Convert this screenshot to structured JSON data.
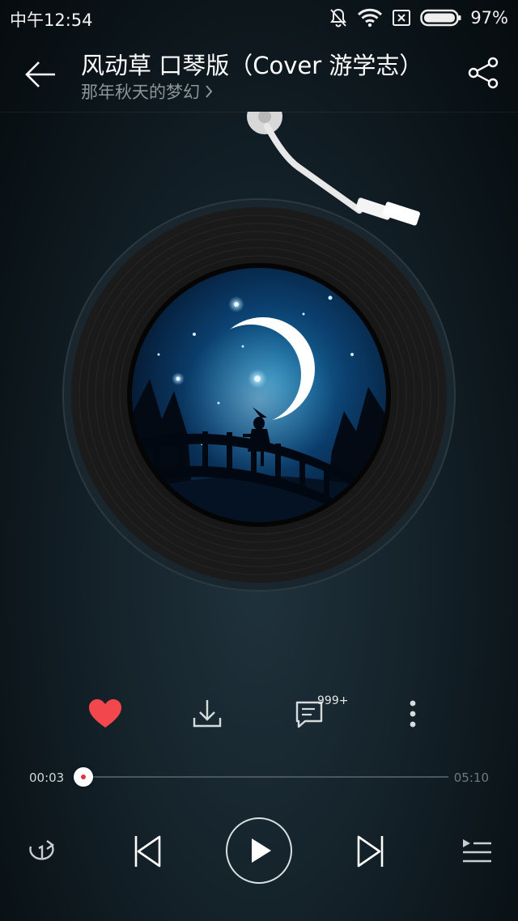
{
  "status_bar": {
    "time": "中午12:54",
    "battery": "97%",
    "icons": [
      "bell-muted-icon",
      "wifi-icon",
      "no-sim-icon",
      "battery-icon"
    ]
  },
  "header": {
    "title": "风动草 口琴版（Cover 游学志）",
    "artist": "那年秋天的梦幻",
    "icons": [
      "back-arrow-icon",
      "chevron-right-icon",
      "share-icon"
    ]
  },
  "actions": {
    "comment_count": "999+",
    "like_color": "#f1474d",
    "icons": [
      "heart-icon",
      "download-icon",
      "comment-icon",
      "more-vertical-icon"
    ]
  },
  "progress": {
    "current": "00:03",
    "total": "05:10",
    "fraction": 0.01
  },
  "controls": {
    "icons": [
      "repeat-one-icon",
      "previous-icon",
      "play-icon",
      "next-icon",
      "playlist-icon"
    ]
  }
}
